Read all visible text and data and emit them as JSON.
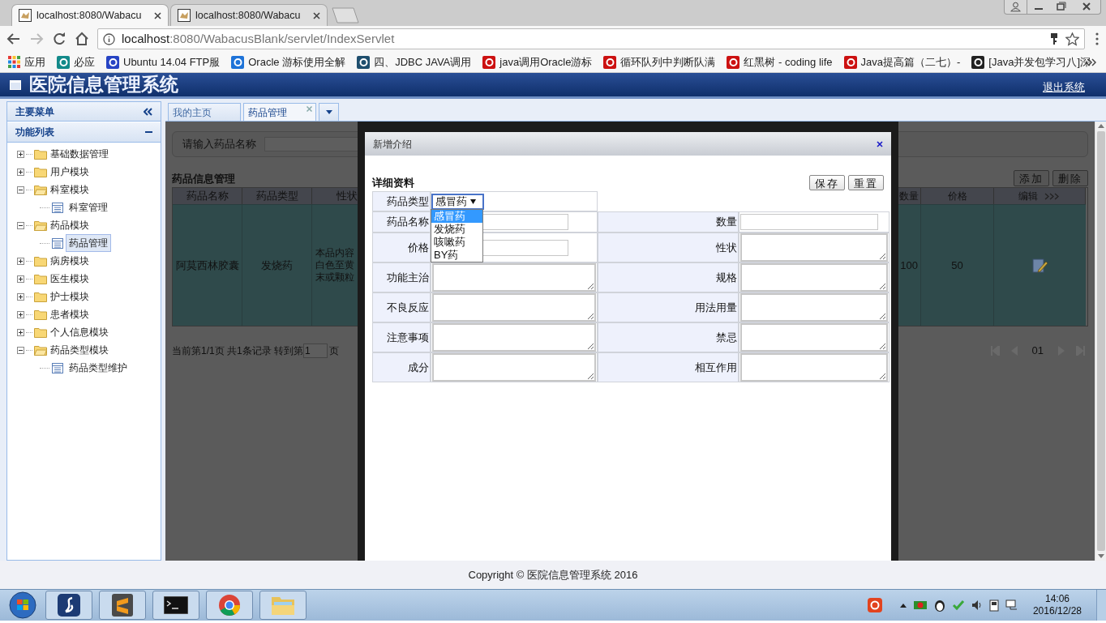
{
  "browser": {
    "tabs": [
      {
        "title": "localhost:8080/Wabacu",
        "selected": true
      },
      {
        "title": "localhost:8080/Wabacu",
        "selected": false
      }
    ],
    "url": {
      "host": "localhost",
      "path": ":8080/WabacusBlank/servlet/IndexServlet"
    },
    "bookmarks": [
      "应用",
      "必应",
      "Ubuntu 14.04 FTP服",
      "Oracle 游标使用全解",
      "四、JDBC JAVA调用",
      "java调用Oracle游标",
      "循环队列中判断队满",
      "红黑树 - coding life",
      "Java提高篇（二七）-",
      "[Java并发包学习八]深"
    ]
  },
  "app": {
    "title": "医院信息管理系统",
    "logout": "退出系统"
  },
  "sidebar": {
    "header": "主要菜单",
    "section": "功能列表",
    "tree": [
      {
        "label": "基础数据管理",
        "expanded": false
      },
      {
        "label": "用户模块",
        "expanded": false
      },
      {
        "label": "科室模块",
        "expanded": true,
        "children": [
          {
            "label": "科室管理",
            "selected": false
          }
        ]
      },
      {
        "label": "药品模块",
        "expanded": true,
        "children": [
          {
            "label": "药品管理",
            "selected": true
          }
        ]
      },
      {
        "label": "病房模块",
        "expanded": false
      },
      {
        "label": "医生模块",
        "expanded": false
      },
      {
        "label": "护士模块",
        "expanded": false
      },
      {
        "label": "患者模块",
        "expanded": false
      },
      {
        "label": "个人信息模块",
        "expanded": false
      },
      {
        "label": "药品类型模块",
        "expanded": true,
        "children": [
          {
            "label": "药品类型维护",
            "selected": false
          }
        ]
      }
    ]
  },
  "content": {
    "tabs": [
      {
        "label": "我的主页",
        "selected": false
      },
      {
        "label": "药品管理",
        "selected": true
      }
    ],
    "search_label": "请输入药品名称",
    "table": {
      "title": "药品信息管理",
      "buttons": [
        "添加",
        "删除"
      ],
      "left_columns": [
        "药品名称",
        "药品类型",
        "性状"
      ],
      "right_columns": [
        "数量",
        "价格",
        "编辑"
      ],
      "rows": [
        {
          "name": "阿莫西林胶囊",
          "type": "发烧药",
          "description": [
            "本品内容",
            "白色至黄",
            "末或颗粒"
          ],
          "quantity": "100",
          "price": "50"
        }
      ]
    },
    "pager": {
      "text": "当前第1/1页 共1条记录 转到第",
      "page_input": "1",
      "suffix": "页",
      "current": "01"
    }
  },
  "dialog": {
    "title": "新增介绍",
    "section": "详细资料",
    "buttons": [
      "保存",
      "重置"
    ],
    "type_field": {
      "label": "药品类型",
      "value": "感冒药",
      "expanded": true,
      "options": [
        {
          "label": "感冒药",
          "selected": true
        },
        {
          "label": "发烧药",
          "selected": false
        },
        {
          "label": "咳嗽药",
          "selected": false
        },
        {
          "label": "BY药",
          "selected": false
        }
      ]
    },
    "rows": [
      [
        {
          "label": "药品名称",
          "kind": "input"
        },
        {
          "label": "数量",
          "kind": "input"
        }
      ],
      [
        {
          "label": "价格",
          "kind": "input"
        },
        {
          "label": "性状",
          "kind": "textarea"
        }
      ],
      [
        {
          "label": "功能主治",
          "kind": "textarea"
        },
        {
          "label": "规格",
          "kind": "textarea"
        }
      ],
      [
        {
          "label": "不良反应",
          "kind": "textarea"
        },
        {
          "label": "用法用量",
          "kind": "textarea"
        }
      ],
      [
        {
          "label": "注意事项",
          "kind": "textarea"
        },
        {
          "label": "禁忌",
          "kind": "textarea"
        }
      ],
      [
        {
          "label": "成分",
          "kind": "textarea"
        },
        {
          "label": "相互作用",
          "kind": "textarea"
        }
      ]
    ]
  },
  "footer": "Copyright © 医院信息管理系统 2016",
  "taskbar": {
    "time": "14:06",
    "date": "2016/12/28"
  }
}
